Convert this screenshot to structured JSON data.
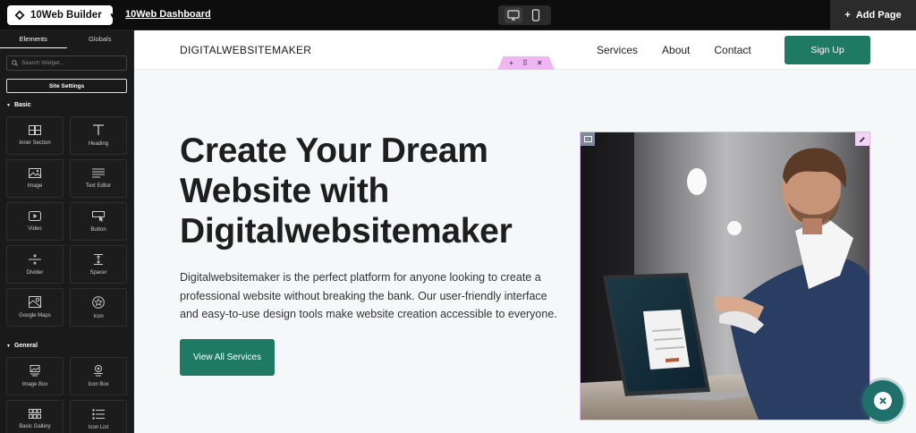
{
  "topbar": {
    "brand_label": "10Web Builder",
    "dashboard_link": "10Web Dashboard",
    "add_page_label": "Add Page",
    "add_page_icon": "plus-icon"
  },
  "sidebar": {
    "tabs": [
      {
        "label": "Elements",
        "active": true
      },
      {
        "label": "Globals",
        "active": false
      }
    ],
    "search_placeholder": "Search Widget...",
    "site_settings_label": "Site Settings",
    "sections": [
      {
        "title": "Basic",
        "widgets": [
          {
            "label": "Inner Section",
            "icon": "columns-icon"
          },
          {
            "label": "Heading",
            "icon": "heading-icon"
          },
          {
            "label": "Image",
            "icon": "image-icon"
          },
          {
            "label": "Text Editor",
            "icon": "text-lines-icon"
          },
          {
            "label": "Video",
            "icon": "video-icon"
          },
          {
            "label": "Button",
            "icon": "button-click-icon"
          },
          {
            "label": "Divider",
            "icon": "divider-icon"
          },
          {
            "label": "Spacer",
            "icon": "spacer-icon"
          },
          {
            "label": "Google Maps",
            "icon": "map-icon"
          },
          {
            "label": "Icon",
            "icon": "star-icon"
          }
        ]
      },
      {
        "title": "General",
        "widgets": [
          {
            "label": "Image Box",
            "icon": "image-box-icon"
          },
          {
            "label": "Icon Box",
            "icon": "icon-box-icon"
          },
          {
            "label": "Basic Gallery",
            "icon": "gallery-icon"
          },
          {
            "label": "Icon List",
            "icon": "list-icon"
          }
        ]
      }
    ]
  },
  "site": {
    "logo": "DIGITALWEBSITEMAKER",
    "nav": [
      "Services",
      "About",
      "Contact"
    ],
    "signup_label": "Sign Up",
    "hero_title": "Create Your Dream Website with Digitalwebsitemaker",
    "hero_text": "Digitalwebsitemaker is the perfect platform for anyone looking to create a professional website without breaking the bank. Our user-friendly interface and easy-to-use design tools make website creation accessible to everyone.",
    "cta_label": "View All Services",
    "accent_color": "#1f7a64"
  }
}
